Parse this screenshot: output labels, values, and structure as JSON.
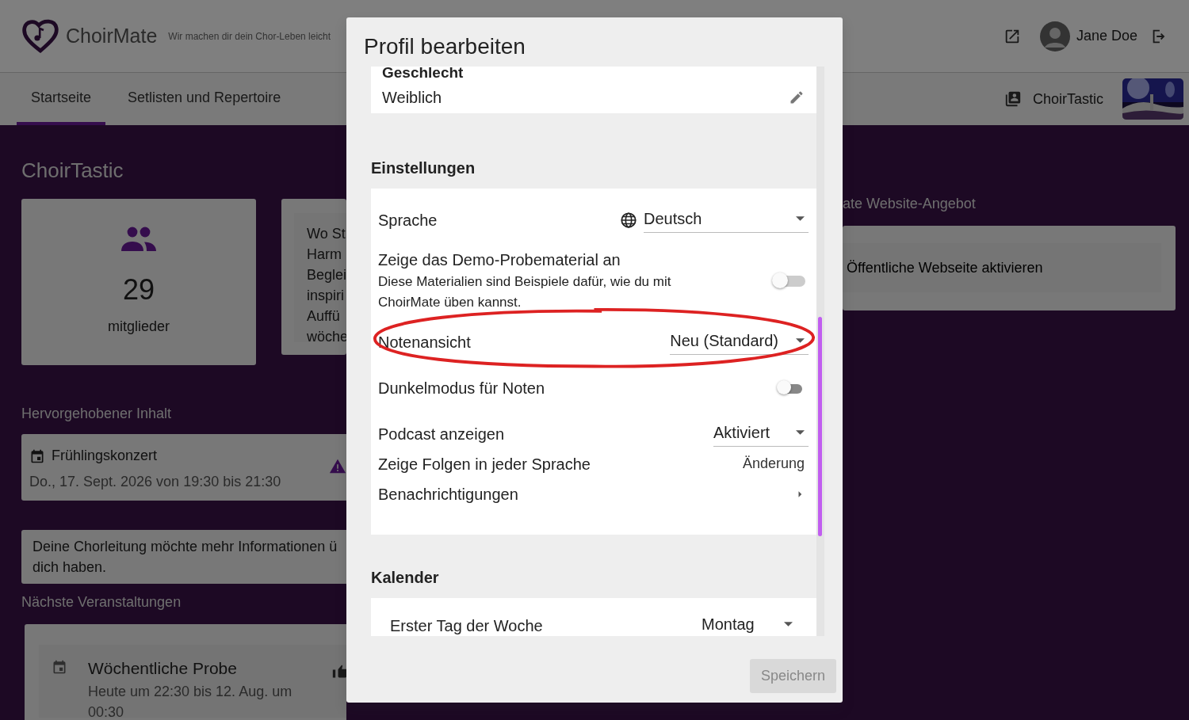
{
  "header": {
    "brand": "ChoirMate",
    "tagline": "Wir machen dir dein Chor-Leben leicht",
    "user_name": "Jane Doe"
  },
  "nav": {
    "tabs": [
      {
        "label": "Startseite",
        "selected": true
      },
      {
        "label": "Setlisten und Repertoire",
        "selected": false
      }
    ],
    "choir_name": "ChoirTastic"
  },
  "page": {
    "title": "ChoirTastic",
    "members": {
      "count": "29",
      "label": "mitglieder"
    },
    "description_lines": [
      "Wo St",
      "Harm",
      "Beglei",
      "inspiri",
      "Auffü",
      "wöche"
    ],
    "featured": {
      "heading": "Hervorgehobener Inhalt",
      "title": "Frühlingskonzert",
      "date": "Do., 17. Sept. 2026 von 19:30 bis 21:30"
    },
    "notice_lines": [
      "Deine Chorleitung möchte mehr Informationen ü",
      "dich haben."
    ],
    "upcoming": {
      "heading": "Nächste Veranstaltungen",
      "events": [
        {
          "title": "Wöchentliche Probe",
          "time": "Heute um 22:30 bis 12. Aug. um 00:30"
        }
      ]
    },
    "website": {
      "heading": "ate Website-Angebot",
      "button": "Öffentliche Webseite aktivieren"
    }
  },
  "dialog": {
    "title": "Profil bearbeiten",
    "gender": {
      "label": "Geschlecht",
      "value": "Weiblich"
    },
    "settings": {
      "heading": "Einstellungen",
      "rows": [
        {
          "kind": "language",
          "label": "Sprache",
          "value": "Deutsch",
          "circled": false
        },
        {
          "kind": "toggle",
          "label": "Zeige das Demo-Probematerial an",
          "description": "Diese Materialien sind Beispiele dafür, wie du mit ChoirMate üben kannst.",
          "on": false,
          "disabled": false,
          "circled": false
        },
        {
          "kind": "select",
          "label": "Notenansicht",
          "value": "Neu (Standard)",
          "circled": true
        },
        {
          "kind": "toggle",
          "label": "Dunkelmodus für Noten",
          "on": false,
          "disabled": true,
          "circled": false
        },
        {
          "kind": "select",
          "label": "Podcast anzeigen",
          "value": "Aktiviert",
          "circled": false
        },
        {
          "kind": "link",
          "label": "Zeige Folgen in jeder Sprache",
          "value": "Änderung",
          "circled": false
        },
        {
          "kind": "nav",
          "label": "Benachrichtigungen",
          "circled": false
        }
      ]
    },
    "calendar": {
      "heading": "Kalender",
      "rows": [
        {
          "kind": "select",
          "label": "Erster Tag der Woche",
          "value": "Montag",
          "circled": false
        }
      ]
    },
    "save_button": {
      "label": "Speichern",
      "disabled": true
    }
  }
}
